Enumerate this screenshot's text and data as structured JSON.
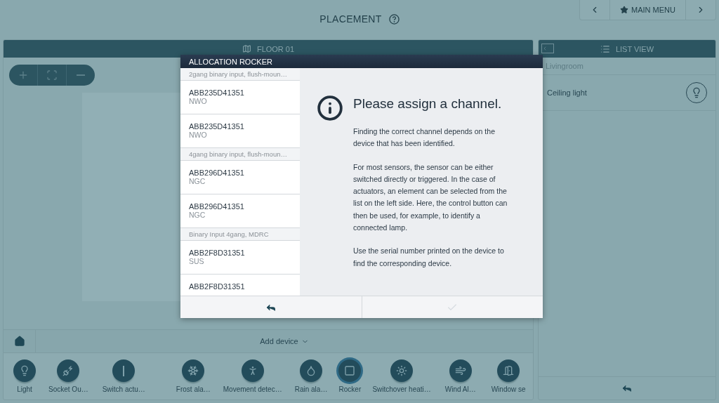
{
  "header": {
    "title": "PLACEMENT",
    "nav": {
      "label": "MAIN MENU"
    }
  },
  "floor_panel": {
    "title": "FLOOR 01"
  },
  "list_panel": {
    "title": "LIST VIEW",
    "sections": [
      {
        "name": "Livingroom",
        "items": [
          {
            "label": "Ceiling light"
          }
        ]
      }
    ]
  },
  "dialog": {
    "title": "ALLOCATION ROCKER",
    "groups": [
      {
        "name": "2gang binary input, flush-moun…",
        "devices": [
          {
            "serial": "ABB235D41351",
            "code": "NWO"
          },
          {
            "serial": "ABB235D41351",
            "code": "NWO"
          }
        ]
      },
      {
        "name": "4gang binary input, flush-moun…",
        "devices": [
          {
            "serial": "ABB296D41351",
            "code": "NGC"
          },
          {
            "serial": "ABB296D41351",
            "code": "NGC"
          }
        ]
      },
      {
        "name": "Binary Input 4gang, MDRC",
        "devices": [
          {
            "serial": "ABB2F8D31351",
            "code": "SUS"
          },
          {
            "serial": "ABB2F8D31351"
          }
        ]
      }
    ],
    "heading": "Please assign a channel.",
    "paragraphs": [
      "Finding the correct channel depends on the device that has been identified.",
      "For most sensors, the sensor can be either switched directly or triggered. In the case of actuators, an element can be selected from the list on the left side. Here, the control button can then be used, for example, to identify a connected lamp.",
      "Use the serial number printed on the device to find the corresponding device."
    ],
    "confirm_disabled": true
  },
  "add_device": {
    "label": "Add device"
  },
  "devices": [
    {
      "kind": "light",
      "label": "Light",
      "selected": false
    },
    {
      "kind": "socket",
      "label": "Socket Ou…",
      "selected": false
    },
    {
      "kind": "switch",
      "label": "Switch actu…",
      "selected": false
    },
    {
      "kind": "frost",
      "label": "Frost ala…",
      "selected": false
    },
    {
      "kind": "movement",
      "label": "Movement detec…",
      "selected": false
    },
    {
      "kind": "rain",
      "label": "Rain ala…",
      "selected": false
    },
    {
      "kind": "rocker",
      "label": "Rocker",
      "selected": true
    },
    {
      "kind": "heating",
      "label": "Switchover heati…",
      "selected": false
    },
    {
      "kind": "wind",
      "label": "Wind Al…",
      "selected": false
    },
    {
      "kind": "window",
      "label": "Window se",
      "selected": false
    }
  ]
}
